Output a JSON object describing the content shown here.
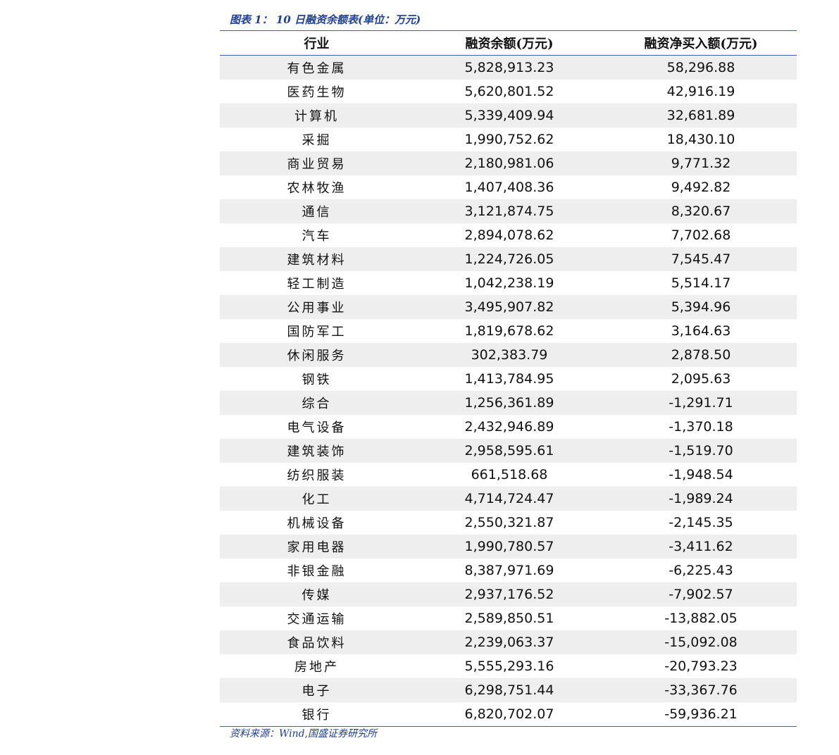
{
  "caption": "图表 1： 10 日融资余额表(单位：万元)",
  "columns": {
    "industry": "行业",
    "balance": "融资余额(万元)",
    "net_buy": "融资净买入额(万元)"
  },
  "rows": [
    {
      "industry": "有色金属",
      "balance": "5,828,913.23",
      "net_buy": "58,296.88"
    },
    {
      "industry": "医药生物",
      "balance": "5,620,801.52",
      "net_buy": "42,916.19"
    },
    {
      "industry": "计算机",
      "balance": "5,339,409.94",
      "net_buy": "32,681.89"
    },
    {
      "industry": "采掘",
      "balance": "1,990,752.62",
      "net_buy": "18,430.10"
    },
    {
      "industry": "商业贸易",
      "balance": "2,180,981.06",
      "net_buy": "9,771.32"
    },
    {
      "industry": "农林牧渔",
      "balance": "1,407,408.36",
      "net_buy": "9,492.82"
    },
    {
      "industry": "通信",
      "balance": "3,121,874.75",
      "net_buy": "8,320.67"
    },
    {
      "industry": "汽车",
      "balance": "2,894,078.62",
      "net_buy": "7,702.68"
    },
    {
      "industry": "建筑材料",
      "balance": "1,224,726.05",
      "net_buy": "7,545.47"
    },
    {
      "industry": "轻工制造",
      "balance": "1,042,238.19",
      "net_buy": "5,514.17"
    },
    {
      "industry": "公用事业",
      "balance": "3,495,907.82",
      "net_buy": "5,394.96"
    },
    {
      "industry": "国防军工",
      "balance": "1,819,678.62",
      "net_buy": "3,164.63"
    },
    {
      "industry": "休闲服务",
      "balance": "302,383.79",
      "net_buy": "2,878.50"
    },
    {
      "industry": "钢铁",
      "balance": "1,413,784.95",
      "net_buy": "2,095.63"
    },
    {
      "industry": "综合",
      "balance": "1,256,361.89",
      "net_buy": "-1,291.71"
    },
    {
      "industry": "电气设备",
      "balance": "2,432,946.89",
      "net_buy": "-1,370.18"
    },
    {
      "industry": "建筑装饰",
      "balance": "2,958,595.61",
      "net_buy": "-1,519.70"
    },
    {
      "industry": "纺织服装",
      "balance": "661,518.68",
      "net_buy": "-1,948.54"
    },
    {
      "industry": "化工",
      "balance": "4,714,724.47",
      "net_buy": "-1,989.24"
    },
    {
      "industry": "机械设备",
      "balance": "2,550,321.87",
      "net_buy": "-2,145.35"
    },
    {
      "industry": "家用电器",
      "balance": "1,990,780.57",
      "net_buy": "-3,411.62"
    },
    {
      "industry": "非银金融",
      "balance": "8,387,971.69",
      "net_buy": "-6,225.43"
    },
    {
      "industry": "传媒",
      "balance": "2,937,176.52",
      "net_buy": "-7,902.57"
    },
    {
      "industry": "交通运输",
      "balance": "2,589,850.51",
      "net_buy": "-13,882.05"
    },
    {
      "industry": "食品饮料",
      "balance": "2,239,063.37",
      "net_buy": "-15,092.08"
    },
    {
      "industry": "房地产",
      "balance": "5,555,293.16",
      "net_buy": "-20,793.23"
    },
    {
      "industry": "电子",
      "balance": "6,298,751.44",
      "net_buy": "-33,367.76"
    },
    {
      "industry": "银行",
      "balance": "6,820,702.07",
      "net_buy": "-59,936.21"
    }
  ],
  "source": "资料来源：Wind,国盛证券研究所"
}
